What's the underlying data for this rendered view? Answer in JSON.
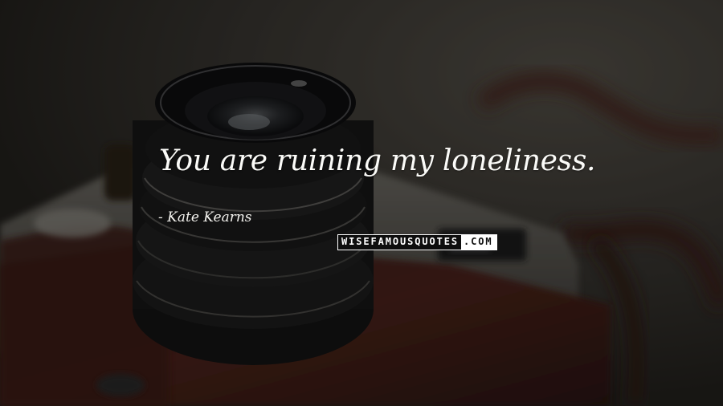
{
  "quote": {
    "text": "You are ruining my loneliness.",
    "author": "- Kate Kearns"
  },
  "watermark": {
    "part1": "WISEFAMOUSQUOTES",
    "part2": ".COM"
  },
  "colors": {
    "quote_text": "#fbfbf8",
    "background": "#1e1c18",
    "leather": "#4a231b"
  }
}
